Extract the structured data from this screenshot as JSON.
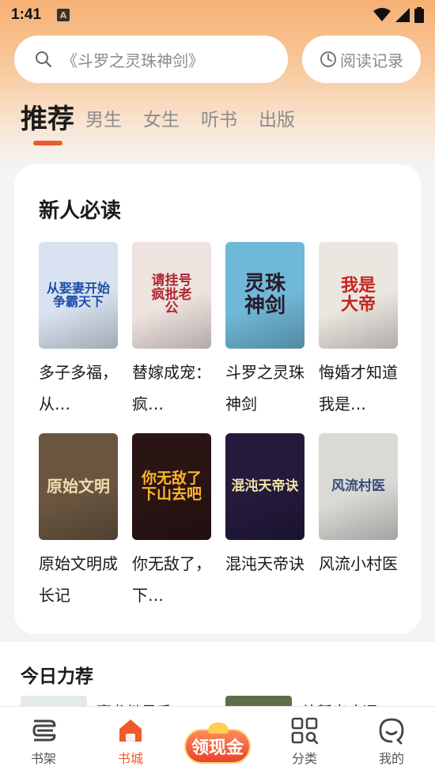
{
  "status": {
    "time": "1:41",
    "notif": "A"
  },
  "search": {
    "placeholder": "《斗罗之灵珠神剑》",
    "history_label": "阅读记录"
  },
  "tabs": [
    "推荐",
    "男生",
    "女生",
    "听书",
    "出版"
  ],
  "section": {
    "title": "新人必读",
    "books": [
      {
        "name": "多子多福，从…",
        "cover_text": "从娶妻开始争霸天下",
        "bg": "#d8e2f0",
        "fg": "#1f4fa8"
      },
      {
        "name": "替嫁成宠：疯…",
        "cover_text": "请挂号疯批老公",
        "bg": "#efe3df",
        "fg": "#b0262f"
      },
      {
        "name": "斗罗之灵珠神剑",
        "cover_text": "灵珠神剑",
        "bg": "#6fb8d8",
        "fg": "#2a1a2a"
      },
      {
        "name": "悔婚才知道我是…",
        "cover_text": "我是大帝",
        "bg": "#ece6e0",
        "fg": "#c0261f"
      },
      {
        "name": "原始文明成长记",
        "cover_text": "原始文明",
        "bg": "#6a5640",
        "fg": "#f3dcae"
      },
      {
        "name": "你无敌了，下…",
        "cover_text": "你无敌了下山去吧",
        "bg": "#2a1414",
        "fg": "#ffb52a"
      },
      {
        "name": "混沌天帝诀",
        "cover_text": "混沌天帝诀",
        "bg": "#231a3c",
        "fg": "#f2e4a8"
      },
      {
        "name": "风流小村医",
        "cover_text": "风流村医",
        "bg": "#d9d9d6",
        "fg": "#3a4c7a"
      }
    ]
  },
  "today": {
    "title": "今日力荐",
    "peek1": "豪龙继星系",
    "peek2": "补暂出病词"
  },
  "nav": [
    {
      "label": "书架",
      "icon": "bookshelf-icon"
    },
    {
      "label": "书城",
      "icon": "home-icon"
    },
    {
      "label": "领现金",
      "icon": "cash-icon"
    },
    {
      "label": "分类",
      "icon": "category-icon"
    },
    {
      "label": "我的",
      "icon": "profile-icon"
    }
  ],
  "colors": {
    "accent": "#f05a28",
    "header_gradient_top": "#f6b074"
  }
}
